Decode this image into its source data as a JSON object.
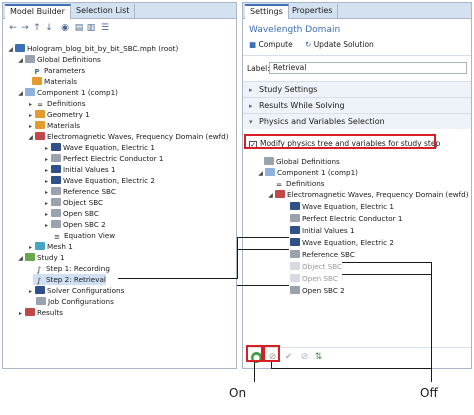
{
  "left_tabs": [
    "Model Builder",
    "Selection List"
  ],
  "right_tabs": [
    "Settings",
    "Properties"
  ],
  "tree": {
    "root": "Hologram_blog_bit_by_bit_SBC.mph (root)",
    "global_definitions": "Global Definitions",
    "parameters": "Parameters",
    "materials_global": "Materials",
    "component": "Component 1 (comp1)",
    "definitions": "Definitions",
    "geometry": "Geometry 1",
    "materials": "Materials",
    "ewfd": "Electromagnetic Waves, Frequency Domain (ewfd)",
    "wave_eq_1": "Wave Equation, Electric 1",
    "pec": "Perfect Electric Conductor 1",
    "initial_values": "Initial Values 1",
    "wave_eq_2": "Wave Equation, Electric 2",
    "reference_sbc": "Reference SBC",
    "object_sbc": "Object SBC",
    "open_sbc": "Open SBC",
    "open_sbc_2": "Open SBC 2",
    "equation_view": "Equation View",
    "mesh": "Mesh 1",
    "study": "Study 1",
    "step1": "Step 1: Recording",
    "step2": "Step 2: Retrieval",
    "solver_configs": "Solver Configurations",
    "job_configs": "Job Configurations",
    "results": "Results"
  },
  "settings": {
    "title": "Wavelength Domain",
    "compute": "Compute",
    "update_solution": "Update Solution",
    "label_caption": "Label:",
    "label_value": "Retrieval",
    "sections": {
      "study_settings": "Study Settings",
      "results_while_solving": "Results While Solving",
      "physics_variables": "Physics and Variables Selection"
    },
    "modify_checkbox": "Modify physics tree and variables for study step",
    "modify_checked": true
  },
  "physics_tree": {
    "global_definitions": "Global Definitions",
    "component": "Component 1 (comp1)",
    "definitions": "Definitions",
    "ewfd": "Electromagnetic Waves, Frequency Domain (ewfd)",
    "wave_eq_1": "Wave Equation, Electric 1",
    "pec": "Perfect Electric Conductor 1",
    "initial_values": "Initial Values 1",
    "wave_eq_2": "Wave Equation, Electric 2",
    "reference_sbc": "Reference SBC",
    "object_sbc": "Object SBC",
    "open_sbc": "Open SBC",
    "open_sbc_2": "Open SBC 2"
  },
  "callouts": {
    "on": "On",
    "off": "Off"
  },
  "icons": {
    "on_button": "enable-icon",
    "off_button": "disable-icon"
  },
  "colors": {
    "accent": "#3d6fb5",
    "highlight": "#d81f26",
    "tab_bar": "#d4e1f1"
  }
}
